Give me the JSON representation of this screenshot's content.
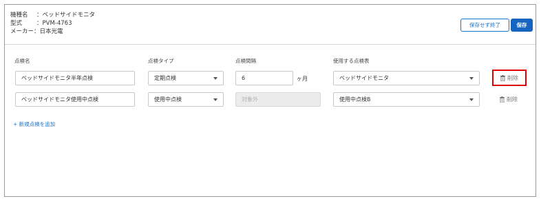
{
  "info": {
    "model_name_label": "機種名",
    "model_name_value": "：ベッドサイドモニタ",
    "model_no_label": "型式",
    "model_no_value": "：PVM-4763",
    "maker_label": "メーカー",
    "maker_value": "：日本光電"
  },
  "toolbar": {
    "exit_label": "保存せず終了",
    "save_label": "保存"
  },
  "columns": {
    "name": "点検名",
    "type": "点検タイプ",
    "interval": "点検間隔",
    "sheet": "使用する点検表"
  },
  "rows": [
    {
      "name": "ベッドサイドモニタ半年点検",
      "type": "定期点検",
      "interval": "6",
      "unit": "ヶ月",
      "sheet": "ベッドサイドモニタ",
      "delete_label": "削除"
    },
    {
      "name": "ベッドサイドモニタ使用中点検",
      "type": "使用中点検",
      "interval_placeholder": "対象外",
      "sheet": "使用中点検B",
      "delete_label": "削除"
    }
  ],
  "add_link": "+ 新規点検を追加",
  "colors": {
    "accent": "#1565c0",
    "highlight": "#e00000"
  }
}
